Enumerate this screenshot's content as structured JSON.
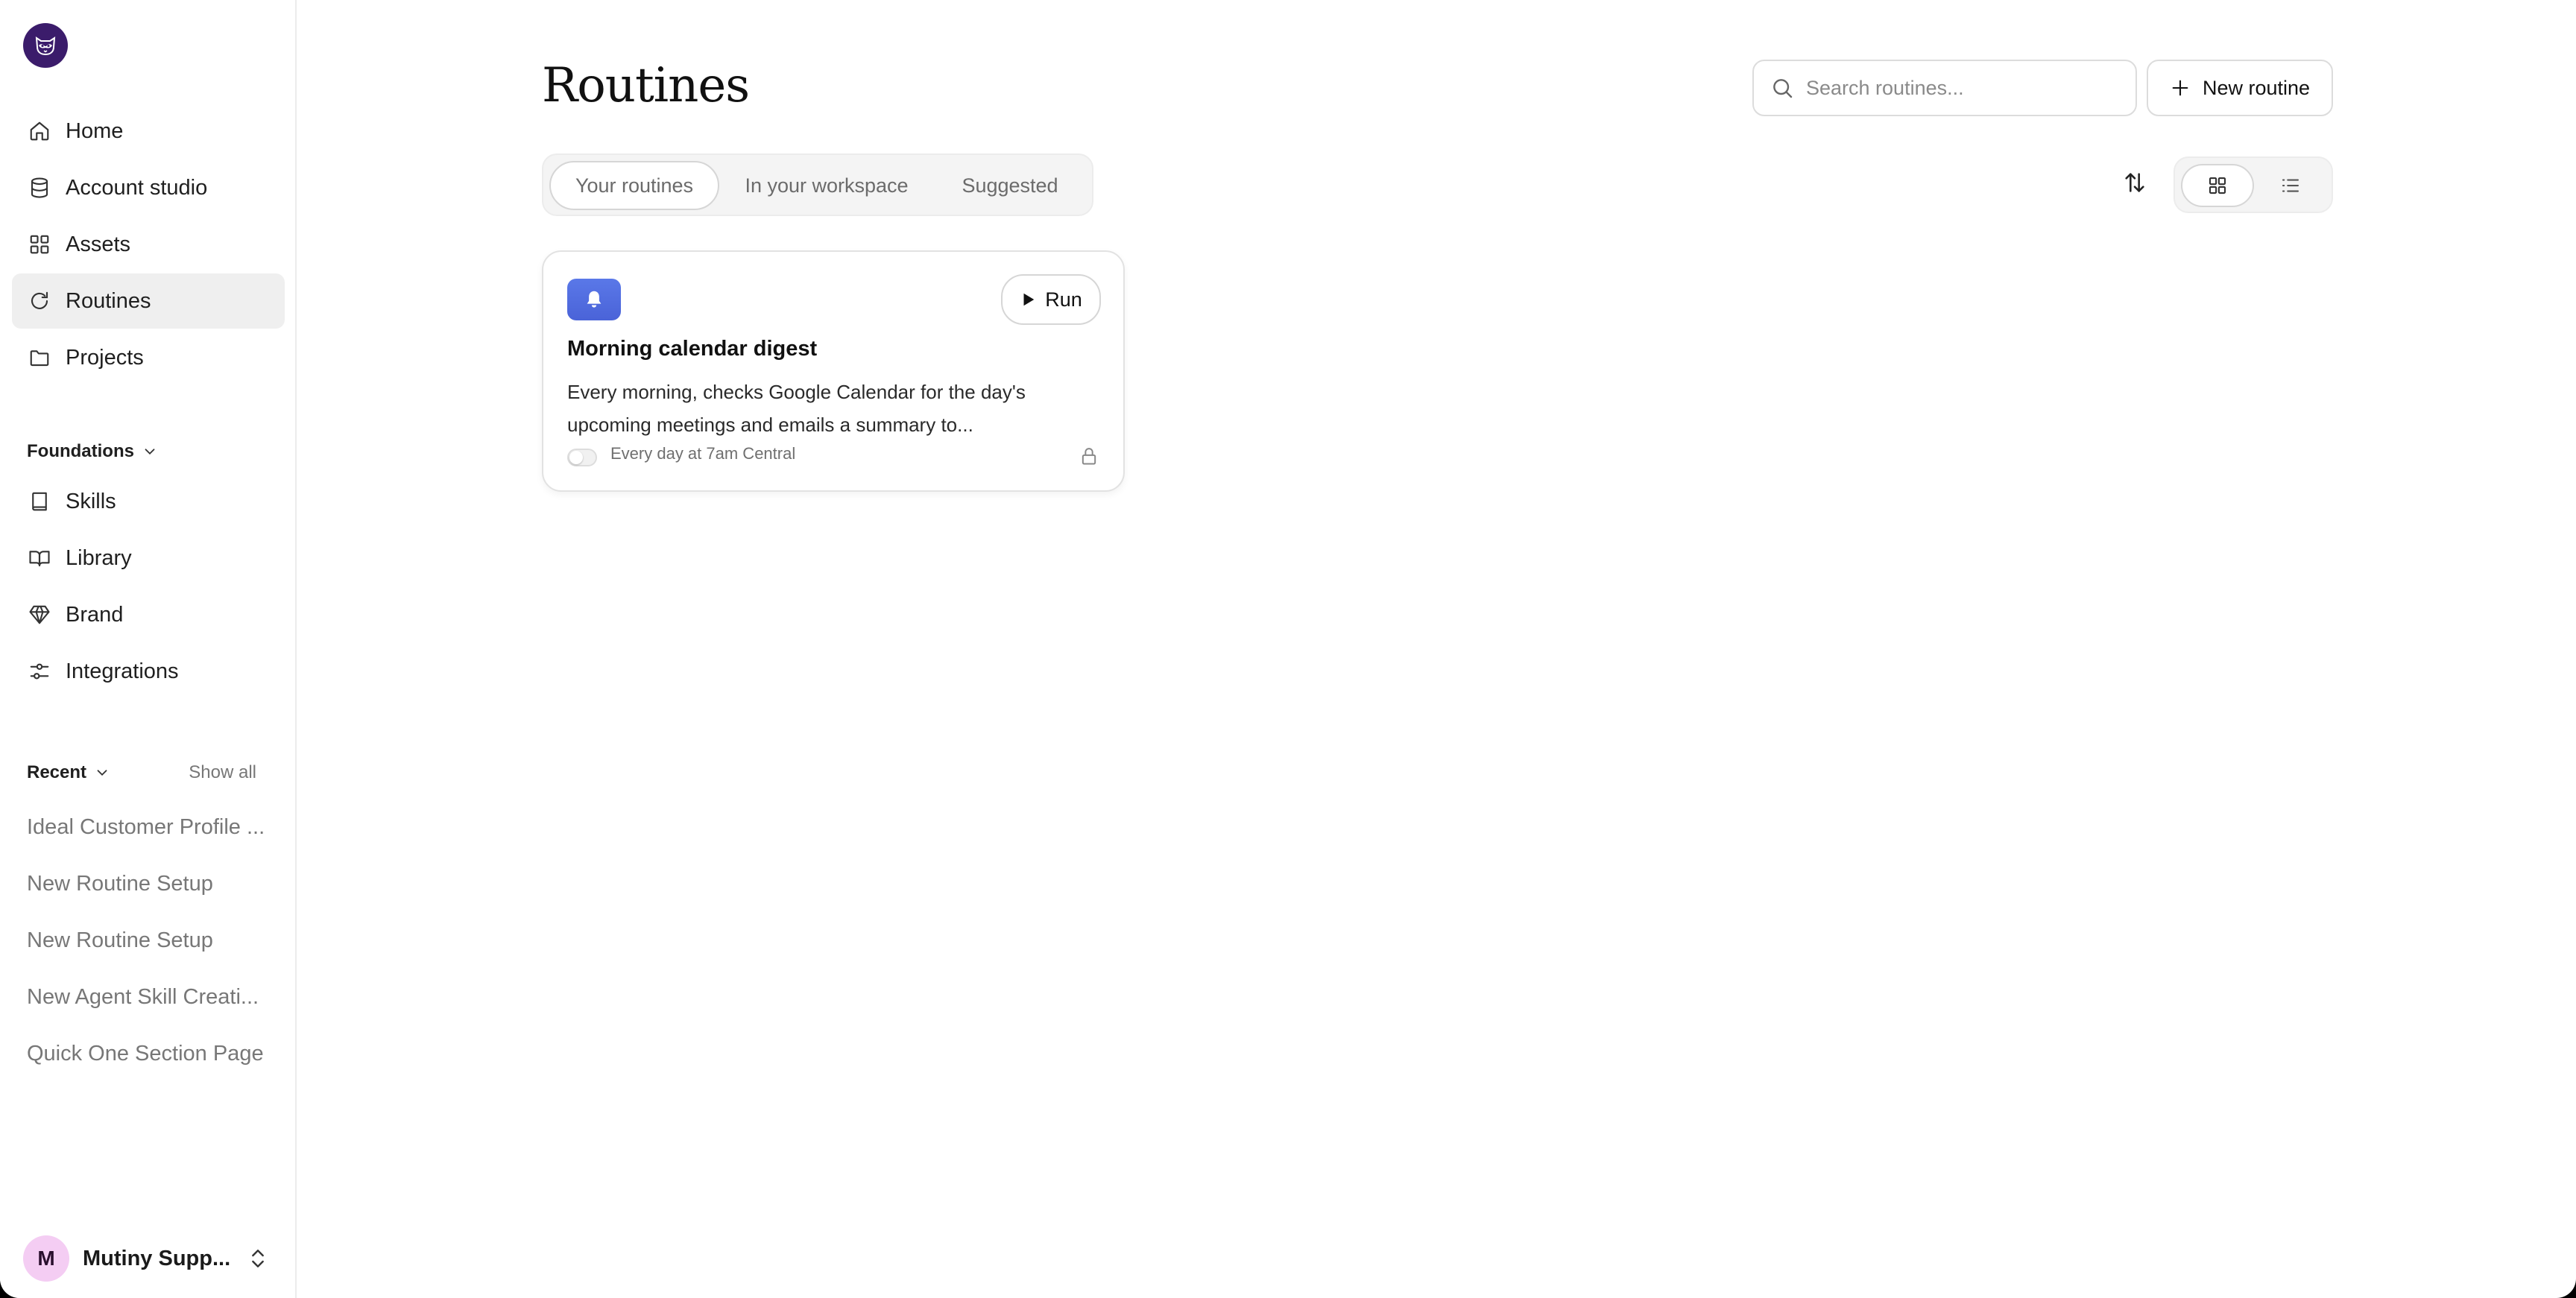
{
  "sidebar": {
    "nav": [
      {
        "label": "Home",
        "icon": "home-icon"
      },
      {
        "label": "Account studio",
        "icon": "database-icon"
      },
      {
        "label": "Assets",
        "icon": "grid-icon"
      },
      {
        "label": "Routines",
        "icon": "refresh-icon",
        "active": true
      },
      {
        "label": "Projects",
        "icon": "folder-icon"
      }
    ],
    "foundations": {
      "label": "Foundations",
      "items": [
        {
          "label": "Skills",
          "icon": "book-icon"
        },
        {
          "label": "Library",
          "icon": "open-book-icon"
        },
        {
          "label": "Brand",
          "icon": "gem-icon"
        },
        {
          "label": "Integrations",
          "icon": "sliders-icon"
        }
      ]
    },
    "recent": {
      "label": "Recent",
      "show_all": "Show all",
      "items": [
        "Ideal Customer Profile ...",
        "New Routine Setup",
        "New Routine Setup",
        "New Agent Skill Creati...",
        "Quick One Section Page"
      ]
    },
    "user": {
      "initial": "M",
      "name": "Mutiny Supp..."
    }
  },
  "main": {
    "title": "Routines",
    "search": {
      "placeholder": "Search routines..."
    },
    "new_button": "New routine",
    "tabs": [
      {
        "label": "Your routines",
        "active": true
      },
      {
        "label": "In your workspace"
      },
      {
        "label": "Suggested"
      }
    ],
    "view_mode": "grid",
    "cards": [
      {
        "title": "Morning calendar digest",
        "description": "Every morning, checks Google Calendar for the day's upcoming meetings and emails a summary to...",
        "run_label": "Run",
        "schedule": "Every day at 7am Central",
        "enabled": false,
        "icon": "bell-icon",
        "icon_color": "#4f6ddf"
      }
    ]
  },
  "colors": {
    "logo_bg": "#3b1c6b",
    "avatar_bg": "#f4cdf3",
    "active_nav_bg": "#efefef"
  }
}
